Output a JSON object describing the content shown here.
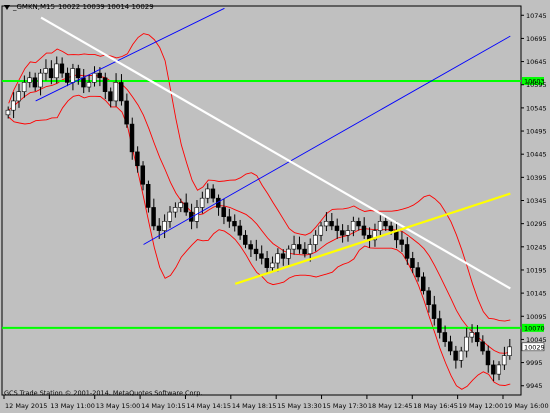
{
  "window": {
    "symbol_label": "_GMKN,M15",
    "ohlc": "10022 10039 10014 10029"
  },
  "copyright": "GCS Trade Station © 2001-2014, MetaQuotes Software Corp.",
  "colors": {
    "background": "#c0c0c0",
    "candle": "#000000",
    "bollinger": "#ff0000",
    "blue_channel": "#0000ff",
    "white_trend": "#ffffff",
    "yellow_trend": "#ffff00",
    "level_lines": "#00ff00"
  },
  "chart_data": {
    "type": "candlestick",
    "indicators": [
      "Bollinger Bands"
    ],
    "y_ticks": [
      "10745",
      "10695",
      "10645",
      "10595",
      "10545",
      "10495",
      "10445",
      "10395",
      "10345",
      "10295",
      "10245",
      "10195",
      "10145",
      "10095",
      "10045",
      "9995",
      "9945"
    ],
    "y_range": [
      9925,
      10765
    ],
    "x_ticks": [
      "12 May 2015",
      "13 May 11:00",
      "13 May 15:00",
      "14 May 10:15",
      "14 May 14:15",
      "14 May 18:15",
      "15 May 13:30",
      "15 May 17:30",
      "18 May 12:45",
      "18 May 16:45",
      "19 May 12:00",
      "19 May 16:00"
    ],
    "horizontal_levels": [
      {
        "label": "10603",
        "value": 10603
      },
      {
        "label": "10070",
        "value": 10070
      }
    ],
    "current_price": {
      "label": "10029",
      "value": 10029
    },
    "close_series": [
      10540,
      10560,
      10580,
      10600,
      10610,
      10590,
      10620,
      10630,
      10610,
      10640,
      10620,
      10600,
      10630,
      10610,
      10590,
      10600,
      10620,
      10610,
      10580,
      10560,
      10600,
      10560,
      10510,
      10450,
      10420,
      10380,
      10330,
      10290,
      10280,
      10300,
      10320,
      10330,
      10340,
      10320,
      10300,
      10330,
      10350,
      10370,
      10350,
      10330,
      10310,
      10300,
      10290,
      10270,
      10250,
      10240,
      10230,
      10220,
      10200,
      10210,
      10230,
      10220,
      10240,
      10250,
      10240,
      10230,
      10250,
      10270,
      10290,
      10300,
      10290,
      10280,
      10270,
      10280,
      10300,
      10290,
      10270,
      10260,
      10280,
      10300,
      10290,
      10280,
      10260,
      10250,
      10220,
      10200,
      10180,
      10150,
      10120,
      10090,
      10060,
      10040,
      10020,
      10000,
      10020,
      10050,
      10060,
      10040,
      10020,
      9990,
      9970,
      9990,
      10010,
      10029
    ]
  }
}
